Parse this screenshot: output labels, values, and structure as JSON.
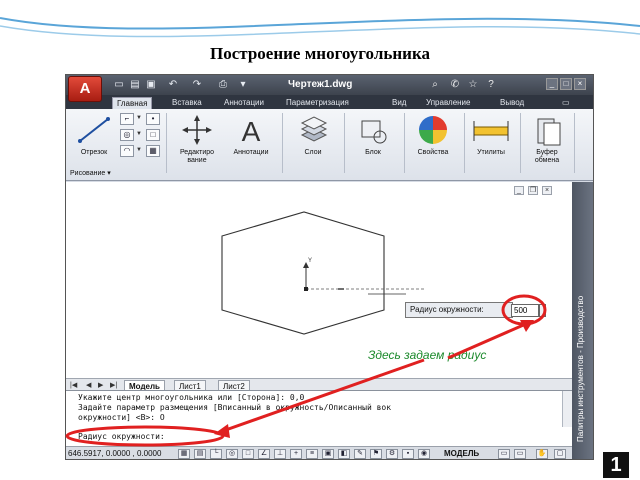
{
  "slide": {
    "title": "Построение многоугольника",
    "page_number": "1",
    "accent_colors": {
      "curve": "#5aa5d8",
      "highlight": "#e02020",
      "annotation": "#1c8a2c"
    }
  },
  "app": {
    "logo_letter": "A",
    "window_title": "Чертеж1.dwg",
    "tabs": [
      "Главная",
      "Вставка",
      "Аннотации",
      "Параметризация",
      "Вид",
      "Управление",
      "Вывод"
    ],
    "active_tab": "Главная",
    "ribbon": {
      "tools": [
        {
          "label": "Отрезок",
          "icon": "line-icon"
        },
        {
          "label": "Редактиро\nвание",
          "icon": "move-icon"
        },
        {
          "label": "Аннотации",
          "icon": "text-a-icon"
        },
        {
          "label": "Слои",
          "icon": "layers-icon"
        },
        {
          "label": "Блок",
          "icon": "block-icon"
        },
        {
          "label": "Свойства",
          "icon": "color-wheel-icon"
        },
        {
          "label": "Утилиты",
          "icon": "measure-icon"
        },
        {
          "label": "Буфер\nобмена",
          "icon": "clipboard-icon"
        }
      ],
      "panel_title": "Рисование"
    },
    "layout_tabs": [
      "Модель",
      "Лист1",
      "Лист2"
    ],
    "active_layout": "Модель",
    "palette_title": "Палитры инструментов - Производство",
    "drawing": {
      "tooltip_label": "Радиус окружности:",
      "tooltip_value": "500"
    },
    "command_line": {
      "history": [
        "Укажите центр многоугольника или [Сторона]: 0,0",
        "Задайте параметр размещения [Вписанный в окружность/Описанный вок",
        "окружности] <В>: О"
      ],
      "prompt": "Радиус окружности:"
    },
    "status": {
      "coordinates": "646.5917, 0.0000 , 0.0000",
      "model_label": "МОДЕЛЬ"
    }
  },
  "annotation": {
    "text": "Здесь задаем радиус"
  }
}
